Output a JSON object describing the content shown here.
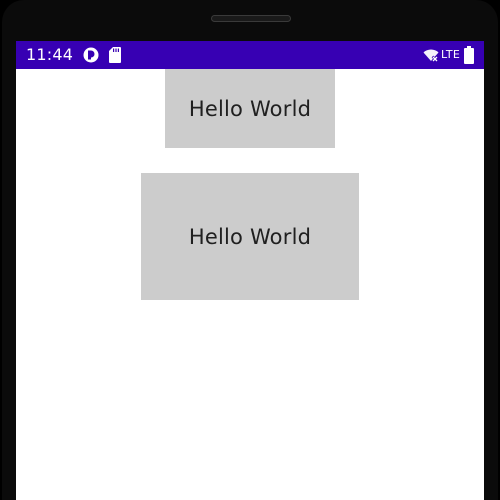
{
  "status_bar": {
    "time": "11:44",
    "network": "LTE",
    "icons": [
      "app-notification-icon",
      "sd-card-icon",
      "wifi-icon",
      "battery-icon"
    ],
    "color": "#3700b3"
  },
  "content": {
    "text_views": [
      {
        "text": "Hello World"
      },
      {
        "text": "Hello World"
      }
    ],
    "text_view_background": "#cccccc",
    "text_color": "#202020"
  }
}
